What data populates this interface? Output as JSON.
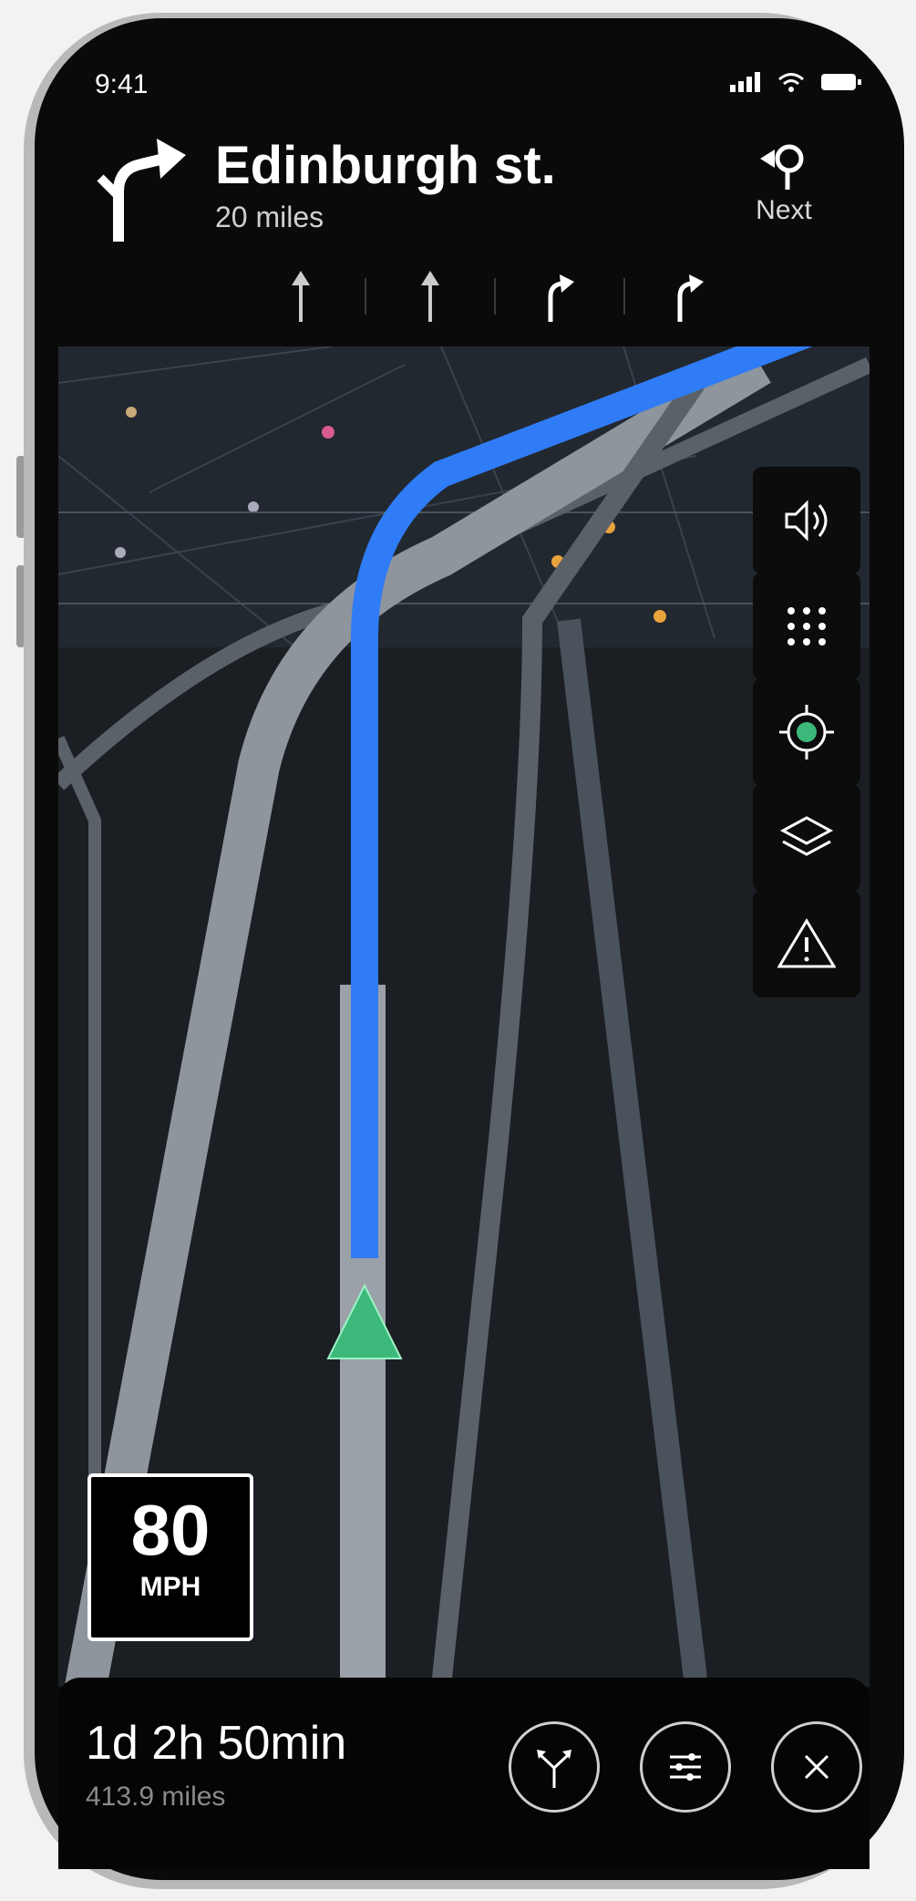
{
  "status_bar": {
    "time": "9:41",
    "signal_icon": "signal-icon",
    "wifi_icon": "wifi-icon",
    "battery_icon": "battery-icon"
  },
  "navigation": {
    "turn_icon": "turn-right-icon",
    "street": "Edinburgh st.",
    "distance": "20 miles",
    "next_label": "Next",
    "next_icon": "roundabout-icon",
    "lanes": [
      "straight-arrow-icon",
      "straight-arrow-icon",
      "turn-right-arrow-icon",
      "turn-right-arrow-icon"
    ]
  },
  "map_controls": [
    "volume-icon",
    "grid-icon",
    "recenter-icon",
    "layers-icon",
    "warning-icon"
  ],
  "speed_limit": {
    "value": "80",
    "unit": "MPH"
  },
  "trip": {
    "eta": "1d 2h 50min",
    "distance": "413.9 miles"
  },
  "bottom_actions": [
    "route-options-icon",
    "settings-sliders-icon",
    "close-icon"
  ],
  "colors": {
    "route": "#2f7cf6",
    "vehicle": "#3cb97a",
    "map_bg": "#1b1f24",
    "road": "#8e959c"
  }
}
